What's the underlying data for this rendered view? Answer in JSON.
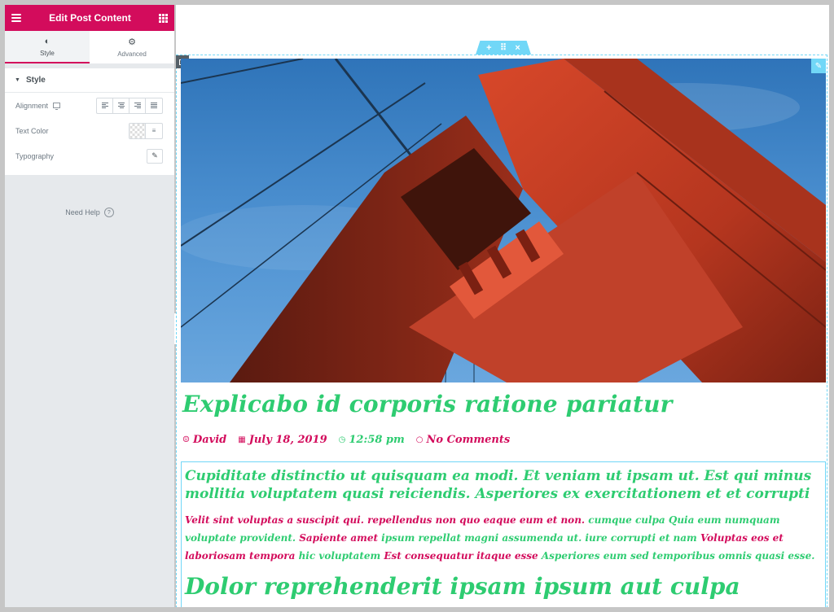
{
  "panel": {
    "title": "Edit Post Content",
    "tabs": [
      {
        "label": "Style",
        "icon": "contrast-icon",
        "active": true
      },
      {
        "label": "Advanced",
        "icon": "gear-icon",
        "active": false
      }
    ],
    "section_title": "Style",
    "controls": {
      "alignment_label": "Alignment",
      "text_color_label": "Text Color",
      "typography_label": "Typography"
    },
    "need_help": "Need Help",
    "need_help_icon": "?",
    "accent_color": "#d30c5c"
  },
  "canvas": {
    "section_handle": {
      "add": "+",
      "drag": "⠿",
      "close": "×"
    },
    "outline_color": "#71d7f7"
  },
  "post": {
    "title": "Explicabo id corporis ratione pariatur",
    "meta": {
      "author": "David",
      "date": "July 18, 2019",
      "time": "12:58 pm",
      "comments": "No Comments"
    },
    "lead": "Cupiditate distinctio ut quisquam ea modi. Et veniam ut ipsam ut. Est qui minus mollitia voluptatem quasi reiciendis. Asperiores ex exercitationem et et corrupti",
    "body_parts": [
      "Velit sint voluptas a suscipit qui. repellendus non quo eaque eum et non. ",
      "cumque culpa Quia eum numquam voluptate provident. ",
      "Sapiente amet ",
      "ipsum repellat magni assumenda ut. iure corrupti et nam ",
      "Voluptas eos et laboriosam tempora ",
      "hic voluptatem ",
      "Est consequatur itaque esse ",
      "Asperiores eum sed temporibus omnis quasi esse."
    ],
    "heading_2": "Dolor reprehenderit ipsam ipsum aut culpa",
    "title_color": "#2ecc71",
    "meta_color": "#d30c5c"
  }
}
